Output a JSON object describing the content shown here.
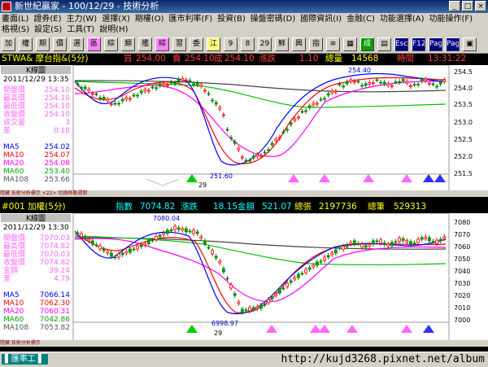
{
  "window": {
    "title": "新世紀贏家 - 100/12/29 - 技術分析",
    "buttons": [
      "_",
      "□",
      "×"
    ]
  },
  "menu": {
    "row1": [
      "畫面(L)",
      "證券(E)",
      "主力(W)",
      "選擇(X)",
      "期權(O)",
      "匯市利率(F)",
      "投資(B)",
      "操盤密碼(D)",
      "國際資訊(I)",
      "金融(C)",
      "功能選擇(A)",
      "功能操作(F)"
    ],
    "row2": [
      "格視(S)",
      "設定(S)",
      "工具(T)",
      "說明(H)"
    ]
  },
  "toolbar": [
    "加",
    "權",
    "期",
    "價",
    "選",
    "區",
    "綜",
    "類",
    "艦",
    "綜",
    "習",
    "委",
    "江",
    "9",
    "8",
    "29",
    "鮮",
    "興",
    "指",
    "≡",
    "▦",
    "成",
    "▤",
    "Esc",
    "F12",
    "Page",
    "Page",
    "▣"
  ],
  "panel1": {
    "symbol": "STWA& 摩台指&(5分)",
    "buy_label": "買",
    "buy": "254.00",
    "sell_label": "賣",
    "sell": "254.10",
    "last_label": "成",
    "last": "254.10",
    "chg_label": "漲跌",
    "chg": "1.10",
    "vol_label": "總量",
    "vol": "14568",
    "time_label": "時間",
    "time": "13:31:22",
    "kbox": "K線圖",
    "date": "2011/12/29 13:35",
    "legend": [
      {
        "k": "開盤價",
        "v": "254.10",
        "color": "#ff66ff"
      },
      {
        "k": "最高價",
        "v": "254.10",
        "color": "#ff66ff"
      },
      {
        "k": "最低價",
        "v": "254.10",
        "color": "#ff66ff"
      },
      {
        "k": "收盤價",
        "v": "254.10",
        "color": "#ff66ff"
      },
      {
        "k": "成交量",
        "v": "3",
        "color": "#ff66ff"
      },
      {
        "k": "差",
        "v": "0.10",
        "color": "#ff66ff"
      },
      {
        "k": "",
        "v": "",
        "color": "#000"
      },
      {
        "k": "MA5",
        "v": "254.02",
        "color": "#0000ff"
      },
      {
        "k": "MA10",
        "v": "254.07",
        "color": "#ff0000"
      },
      {
        "k": "MA20",
        "v": "254.08",
        "color": "#ff00ff"
      },
      {
        "k": "MA60",
        "v": "253.40",
        "color": "#00aa00"
      },
      {
        "k": "MA108",
        "v": "253.66",
        "color": "#555555"
      }
    ],
    "axis": [
      "254.5",
      "254.0",
      "253.5",
      "253.0",
      "252.5",
      "252.0",
      "251.5"
    ],
    "high_label": "254.40",
    "low_label": "251.60",
    "day_label": "29",
    "footer": "隱藏 技術分析標示 <22> 切換移動週期"
  },
  "panel2": {
    "symbol": "#001 加權(5分)",
    "idx_label": "指數",
    "idx": "7074.82",
    "chg_label": "漲跌",
    "chg": "18.15",
    "amt_label": "金額",
    "amt": "521.07",
    "vol_label": "總張",
    "vol": "2197736",
    "cnt_label": "總筆",
    "cnt": "529313",
    "kbox": "K線圖",
    "date": "2011/12/29 13:30",
    "legend": [
      {
        "k": "開盤價",
        "v": "7070.03",
        "color": "#ff66ff"
      },
      {
        "k": "最高價",
        "v": "7074.82",
        "color": "#ff66ff"
      },
      {
        "k": "最低價",
        "v": "7070.03",
        "color": "#ff66ff"
      },
      {
        "k": "收盤價",
        "v": "7074.82",
        "color": "#ff66ff"
      },
      {
        "k": "金額",
        "v": "39.24",
        "color": "#ff66ff"
      },
      {
        "k": "差",
        "v": "4.79",
        "color": "#ff66ff"
      },
      {
        "k": "",
        "v": "",
        "color": "#000"
      },
      {
        "k": "MA5",
        "v": "7066.14",
        "color": "#0000ff"
      },
      {
        "k": "MA10",
        "v": "7062.30",
        "color": "#ff0000"
      },
      {
        "k": "MA20",
        "v": "7060.31",
        "color": "#ff00ff"
      },
      {
        "k": "MA60",
        "v": "7042.86",
        "color": "#00aa00"
      },
      {
        "k": "MA108",
        "v": "7053.82",
        "color": "#555555"
      }
    ],
    "axis": [
      "7080",
      "7070",
      "7060",
      "7050",
      "7040",
      "7030",
      "7020",
      "7010",
      "7000"
    ],
    "high_label": "7080.04",
    "low_label": "6998.97",
    "day_label": "29",
    "footer": "隱藏 技術分析標示"
  },
  "status": {
    "left": "▌匯率工 ▌",
    "right": ""
  },
  "watermark": "http://kujd3268.pixnet.net/album"
}
